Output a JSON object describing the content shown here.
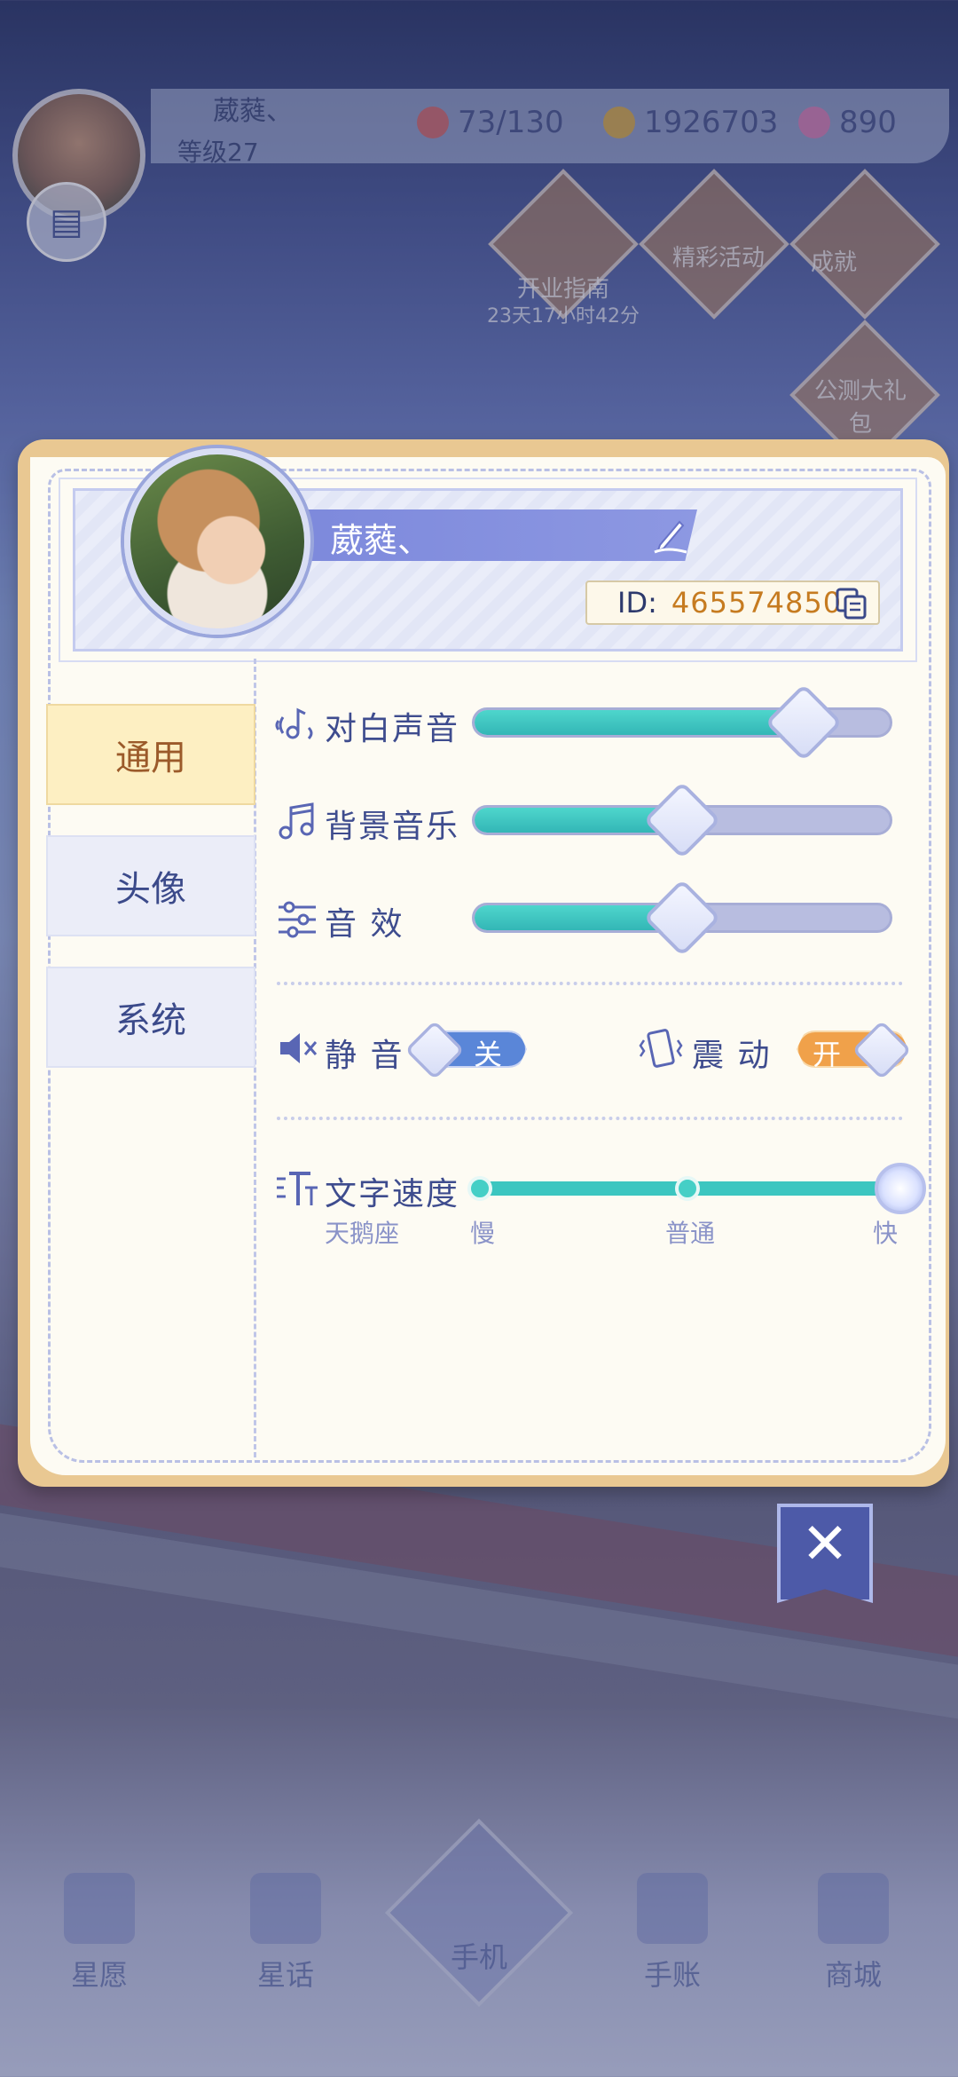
{
  "background_hud": {
    "player_name": "葳蕤、",
    "level": "等级27",
    "stamina": "73/130",
    "coins": "1926703",
    "gems": "890",
    "event_guide": "开业指南",
    "event_timer": "23天17小时42分",
    "event_activity": "精彩活动",
    "event_achievement": "成就",
    "event_gift": "公测大礼包",
    "nav": [
      "星愿",
      "星话",
      "手机",
      "手账",
      "商城"
    ]
  },
  "profile": {
    "name": "葳蕤、",
    "id_label": "ID:",
    "id_value": "465574850"
  },
  "tabs": {
    "general": "通用",
    "avatar": "头像",
    "system": "系统"
  },
  "audio": {
    "dialogue_label": "对白声音",
    "dialogue_level": 0.79,
    "bgm_label": "背景音乐",
    "bgm_level": 0.5,
    "sfx_label": "音 效",
    "sfx_level": 0.5
  },
  "toggles": {
    "mute_label": "静 音",
    "mute_state": "关",
    "vibration_label": "震 动",
    "vibration_state": "开"
  },
  "text_speed": {
    "label": "文字速度",
    "sublabel": "天鹅座",
    "slow": "慢",
    "normal": "普通",
    "fast": "快",
    "selected": "快"
  },
  "close_label": "✕",
  "colors": {
    "accent_blue": "#7d89dc",
    "teal_fill": "#3cc6c0",
    "tab_active_bg": "#fdefc2",
    "id_text": "#c67b20",
    "toggle_on": "#f0a14a",
    "toggle_off": "#5a86d8"
  }
}
